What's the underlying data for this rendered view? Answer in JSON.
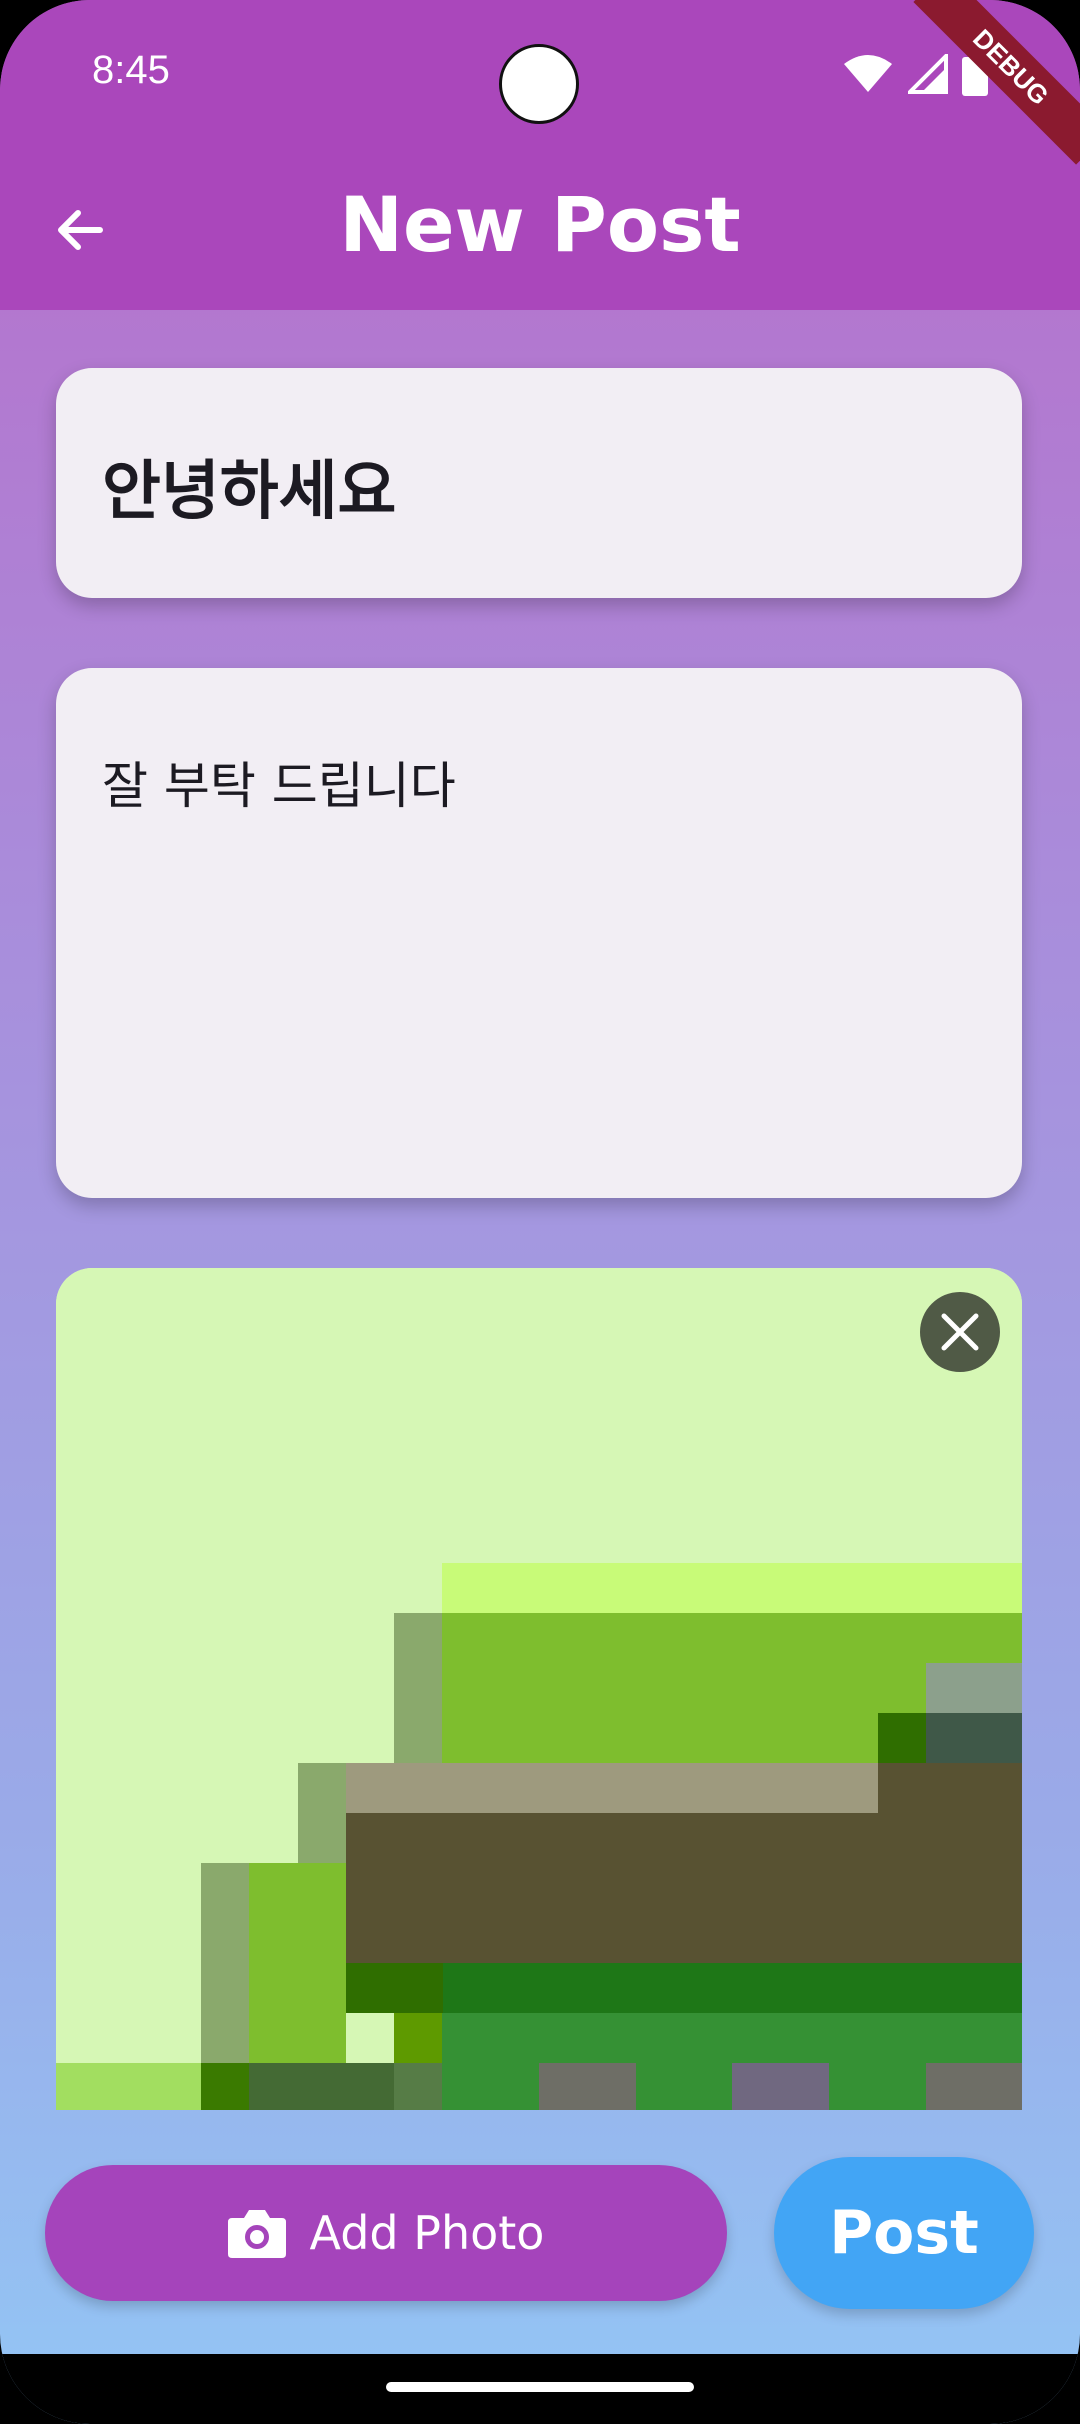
{
  "status_bar": {
    "time": "8:45",
    "debug_label": "DEBUG"
  },
  "appbar": {
    "title": "New Post",
    "back_icon": "arrow-back-icon"
  },
  "post": {
    "title_value": "안녕하세요",
    "body_value": "잘 부탁 드립니다"
  },
  "image": {
    "close_icon": "close-icon"
  },
  "actions": {
    "add_photo_label": "Add Photo",
    "add_photo_icon": "camera-icon",
    "post_label": "Post"
  },
  "colors": {
    "appbar": "#aa47bb",
    "add_photo": "#a544bb",
    "post": "#42a5f5"
  }
}
